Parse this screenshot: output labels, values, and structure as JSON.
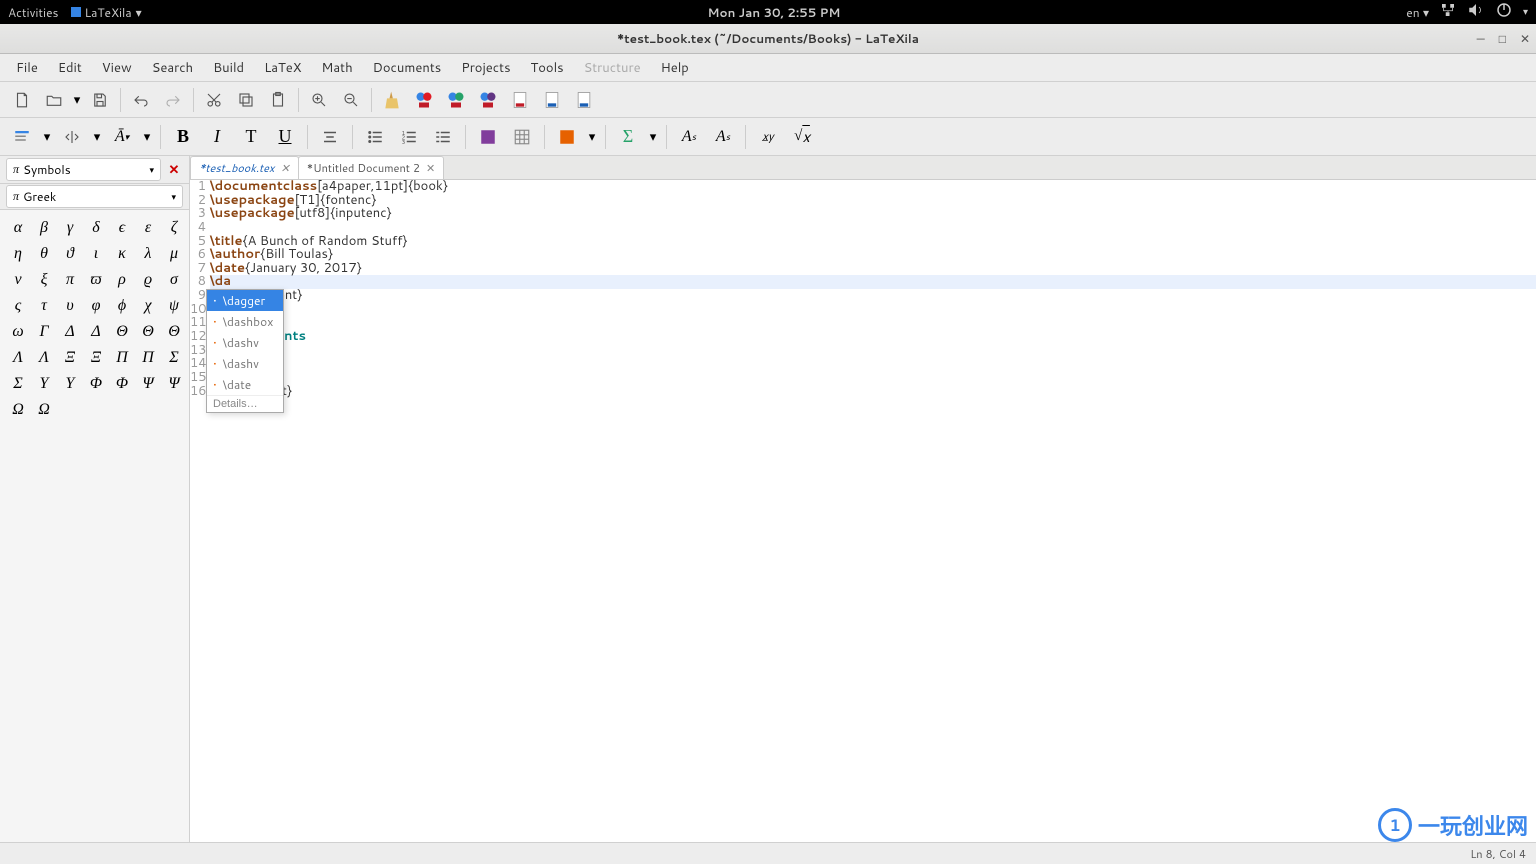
{
  "sysbar": {
    "activities": "Activities",
    "app_name": "LaTeXila",
    "datetime": "Mon Jan 30,  2:55 PM",
    "lang": "en"
  },
  "titlebar": {
    "title": "*test_book.tex (~/Documents/Books) - LaTeXila"
  },
  "menubar": {
    "items": [
      "File",
      "Edit",
      "View",
      "Search",
      "Build",
      "LaTeX",
      "Math",
      "Documents",
      "Projects",
      "Tools",
      "Structure",
      "Help"
    ],
    "disabled_index": 10
  },
  "sidepanel": {
    "category_label": "Symbols",
    "subcategory_label": "Greek",
    "pi_symbol": "π",
    "symbols": [
      "α",
      "β",
      "γ",
      "δ",
      "ϵ",
      "ε",
      "ζ",
      "η",
      "θ",
      "ϑ",
      "ι",
      "κ",
      "λ",
      "μ",
      "ν",
      "ξ",
      "π",
      "ϖ",
      "ρ",
      "ϱ",
      "σ",
      "ς",
      "τ",
      "υ",
      "φ",
      "ϕ",
      "χ",
      "ψ",
      "ω",
      "Γ",
      "Δ",
      "Δ",
      "Θ",
      "Θ",
      "Θ",
      "Λ",
      "Λ",
      "Ξ",
      "Ξ",
      "Π",
      "Π",
      "Σ",
      "Σ",
      "Υ",
      "Υ",
      "Φ",
      "Φ",
      "Ψ",
      "Ψ",
      "Ω",
      "Ω"
    ]
  },
  "tabs": {
    "items": [
      {
        "label": "*test_book.tex",
        "active": true
      },
      {
        "label": "*Untitled Document 2",
        "active": false
      }
    ]
  },
  "code": {
    "lines": [
      {
        "n": 1,
        "parts": [
          {
            "c": "kw",
            "t": "\\documentclass"
          },
          {
            "c": "txt",
            "t": "[a4paper,11pt]{book}"
          }
        ]
      },
      {
        "n": 2,
        "parts": [
          {
            "c": "kw",
            "t": "\\usepackage"
          },
          {
            "c": "txt",
            "t": "[T1]{fontenc}"
          }
        ]
      },
      {
        "n": 3,
        "parts": [
          {
            "c": "kw",
            "t": "\\usepackage"
          },
          {
            "c": "txt",
            "t": "[utf8]{inputenc}"
          }
        ]
      },
      {
        "n": 4,
        "parts": []
      },
      {
        "n": 5,
        "parts": [
          {
            "c": "kw",
            "t": "\\title"
          },
          {
            "c": "txt",
            "t": "{A Bunch of Random Stuff}"
          }
        ]
      },
      {
        "n": 6,
        "parts": [
          {
            "c": "kw",
            "t": "\\author"
          },
          {
            "c": "txt",
            "t": "{Bill Toulas}"
          }
        ]
      },
      {
        "n": 7,
        "parts": [
          {
            "c": "kw",
            "t": "\\date"
          },
          {
            "c": "txt",
            "t": "{January 30, 2017}"
          }
        ]
      },
      {
        "n": 8,
        "parts": [
          {
            "c": "kw",
            "t": "\\da"
          }
        ],
        "highlight": true
      },
      {
        "n": 9,
        "parts": [
          {
            "c": "txt",
            "t": "          pcument}"
          }
        ]
      },
      {
        "n": 10,
        "parts": []
      },
      {
        "n": 11,
        "parts": [
          {
            "c": "kw2",
            "t": "          le"
          }
        ]
      },
      {
        "n": 12,
        "parts": [
          {
            "c": "kw2",
            "t": "          contents"
          }
        ]
      },
      {
        "n": 13,
        "parts": []
      },
      {
        "n": 14,
        "parts": [
          {
            "c": "txt",
            "t": "          {}"
          }
        ]
      },
      {
        "n": 15,
        "parts": []
      },
      {
        "n": 16,
        "parts": [
          {
            "c": "txt",
            "t": "           ument}"
          }
        ]
      }
    ]
  },
  "autocomplete": {
    "items": [
      "\\dagger",
      "\\dashbox",
      "\\dashv",
      "\\dashv",
      "\\date"
    ],
    "selected_index": 0,
    "details": "Details…"
  },
  "statusbar": {
    "position": "Ln 8, Col 4"
  },
  "watermark": {
    "text": "一玩创业网",
    "circle": "1"
  },
  "toolbar_icons": {
    "new": "new-file-icon",
    "open": "open-folder-icon",
    "save": "save-icon",
    "undo": "undo-icon",
    "redo": "redo-icon",
    "cut": "cut-icon",
    "copy": "copy-icon",
    "paste": "paste-icon",
    "zoomin": "zoom-in-icon",
    "zoomout": "zoom-out-icon",
    "build_clean": "broom-icon",
    "build_pdf1": "build-pdf-icon",
    "build_pdf2": "build-pdf2-icon",
    "build_pdf3": "build-pdf3-icon",
    "view_pdf": "view-pdf-icon",
    "view_dvi": "view-dvi-icon",
    "view_ps": "view-ps-icon"
  },
  "toolbar2_labels": {
    "bold": "B",
    "italic": "I",
    "typewriter": "T",
    "underline": "U",
    "superscript": "Aˢ",
    "subscript": "Aₛ",
    "frac": "x/y",
    "sqrt": "√x"
  }
}
